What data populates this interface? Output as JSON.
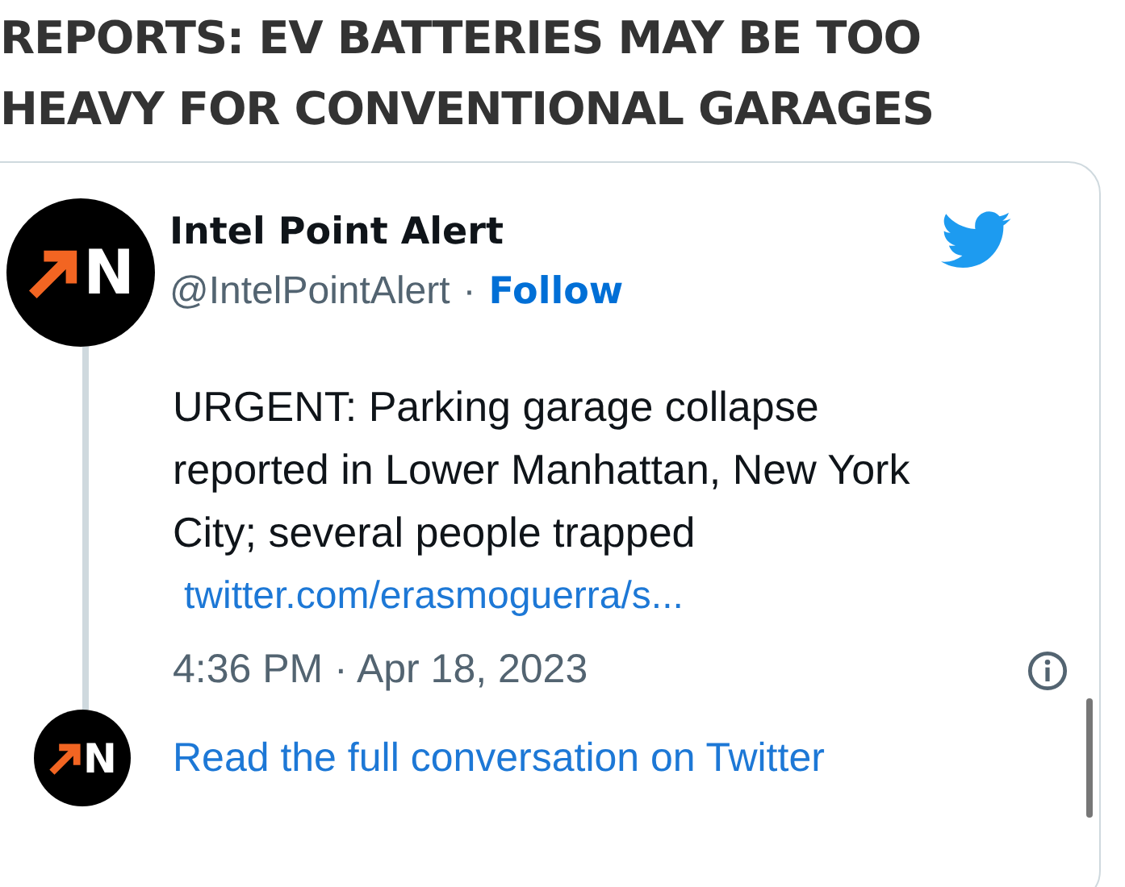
{
  "headline": [
    "REPORTS: EV BATTERIES MAY BE TOO",
    "HEAVY FOR CONVENTIONAL GARAGES"
  ],
  "tweet": {
    "avatar_letter": "N",
    "name": "Intel Point Alert",
    "handle": "@IntelPointAlert",
    "separator": "·",
    "follow": "Follow",
    "text": "URGENT: Parking garage collapse reported in Lower Manhattan, New York City; several people trapped",
    "link": "twitter.com/erasmoguerra/s...",
    "timestamp": "4:36 PM · Apr 18, 2023"
  },
  "footer": {
    "avatar_letter": "N",
    "link": "Read the full conversation on Twitter"
  }
}
